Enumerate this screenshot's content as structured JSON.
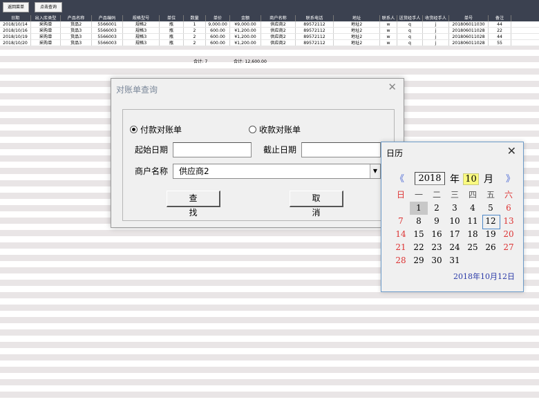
{
  "toolbar": {
    "back_label": "返回菜单",
    "query_label": "点击查询"
  },
  "table": {
    "headers": [
      "日期",
      "出入库类型",
      "产品名称",
      "产品编码",
      "规格型号",
      "单位",
      "数量",
      "单价",
      "金额",
      "商户名称",
      "联系电话",
      "地址",
      "联系人",
      "送货经手人",
      "收货经手人",
      "单号",
      "备注"
    ],
    "rows": [
      [
        "2018/10/14",
        "采购单",
        "货品2",
        "5566001",
        "规格2",
        "瓶",
        "1",
        "9,000.00",
        "¥9,000.00",
        "供应商2",
        "89572112",
        "地址2",
        "w",
        "q",
        "j",
        "201806011030",
        "44"
      ],
      [
        "2018/10/16",
        "采购单",
        "货品3",
        "5566003",
        "规格3",
        "瓶",
        "2",
        "600.00",
        "¥1,200.00",
        "供应商2",
        "89572112",
        "地址2",
        "w",
        "q",
        "j",
        "201806011028",
        "22"
      ],
      [
        "2018/10/19",
        "采购单",
        "货品3",
        "5566003",
        "规格3",
        "瓶",
        "2",
        "600.00",
        "¥1,200.00",
        "供应商2",
        "89572112",
        "地址2",
        "w",
        "q",
        "j",
        "201806011028",
        "44"
      ],
      [
        "2018/10/20",
        "采购单",
        "货品3",
        "5566003",
        "规格3",
        "瓶",
        "2",
        "600.00",
        "¥1,200.00",
        "供应商2",
        "89572112",
        "地址2",
        "w",
        "q",
        "j",
        "201806011028",
        "55"
      ]
    ],
    "sum_count": "合计:  7",
    "sum_amount": "合计:  12,600.00"
  },
  "dialog": {
    "title": "对账单查询",
    "close_glyph": "✕",
    "radio_pay": "付款对账单",
    "radio_receive": "收款对账单",
    "start_date_label": "起始日期",
    "end_date_label": "截止日期",
    "start_date_value": "",
    "end_date_value": "",
    "merchant_label": "商户名称",
    "merchant_value": "供应商2",
    "search_button": "查找",
    "cancel_button": "取消"
  },
  "calendar": {
    "title": "日历",
    "close_glyph": "✕",
    "prev_glyph": "《",
    "next_glyph": "》",
    "year": "2018",
    "year_unit": "年",
    "month": "10",
    "month_unit": "月",
    "weekdays": [
      "日",
      "一",
      "二",
      "三",
      "四",
      "五",
      "六"
    ],
    "leading_blanks": 1,
    "days": [
      "1",
      "2",
      "3",
      "4",
      "5",
      "6",
      "7",
      "8",
      "9",
      "10",
      "11",
      "12",
      "13",
      "14",
      "15",
      "16",
      "17",
      "18",
      "19",
      "20",
      "21",
      "22",
      "23",
      "24",
      "25",
      "26",
      "27",
      "28",
      "29",
      "30",
      "31"
    ],
    "selected_day": "1",
    "today_day": "12",
    "footer": "2018年10月12日",
    "weekend_color": "#d33333"
  }
}
